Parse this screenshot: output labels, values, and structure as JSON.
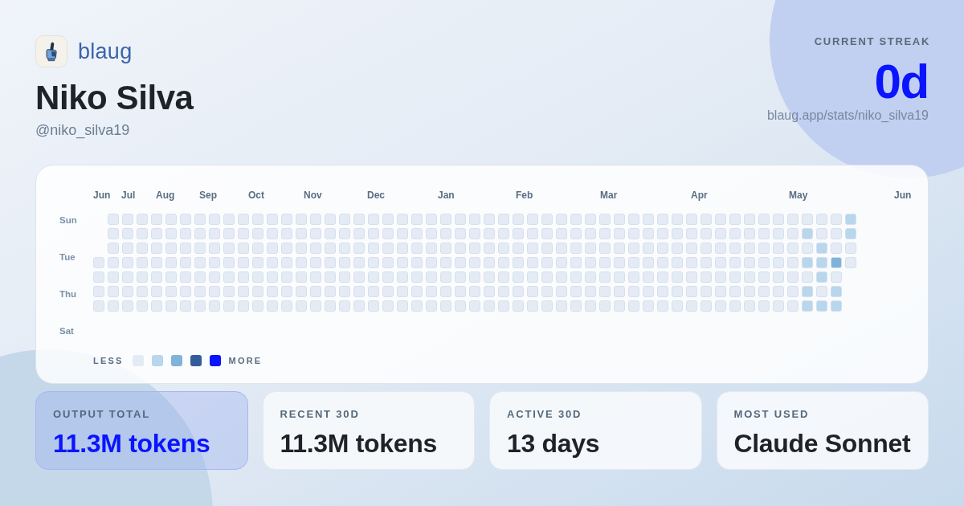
{
  "brand": {
    "name": "blaug"
  },
  "profile": {
    "name": "Niko Silva",
    "handle": "@niko_silva19"
  },
  "streak": {
    "label": "CURRENT STREAK",
    "value": "0d",
    "url": "blaug.app/stats/niko_silva19"
  },
  "heatmap": {
    "months": [
      "Jun",
      "Jul",
      "Aug",
      "Sep",
      "Oct",
      "Nov",
      "Dec",
      "Jan",
      "Feb",
      "Mar",
      "Apr",
      "May",
      "Jun"
    ],
    "weekdays": [
      "Sun",
      "Tue",
      "Thu",
      "Sat"
    ],
    "weeks": [
      {
        "days": [
          {
            "color": "#e4ebf5"
          },
          {
            "color": "#e4ebf5"
          },
          {
            "color": "#e4ebf5"
          },
          {
            "color": "#e4ebf5"
          }
        ]
      },
      {
        "days": [
          {
            "color": "#e4ebf5"
          },
          {
            "color": "#e4ebf5"
          },
          {
            "color": "#e4ebf5"
          },
          {
            "color": "#e4ebf5"
          },
          {
            "color": "#e4ebf5"
          },
          {
            "color": "#e4ebf5"
          },
          {
            "color": "#e4ebf5"
          }
        ]
      },
      {
        "days": [
          {
            "color": "#e4ebf5"
          },
          {
            "color": "#e4ebf5"
          },
          {
            "color": "#e4ebf5"
          },
          {
            "color": "#e4ebf5"
          },
          {
            "color": "#e4ebf5"
          },
          {
            "color": "#e4ebf5"
          },
          {
            "color": "#e4ebf5"
          }
        ]
      },
      {
        "days": [
          {
            "color": "#e4ebf5"
          },
          {
            "color": "#e4ebf5"
          },
          {
            "color": "#e4ebf5"
          },
          {
            "color": "#e4ebf5"
          },
          {
            "color": "#e4ebf5"
          },
          {
            "color": "#e4ebf5"
          },
          {
            "color": "#e4ebf5"
          }
        ]
      },
      {
        "days": [
          {
            "color": "#e4ebf5"
          },
          {
            "color": "#e4ebf5"
          },
          {
            "color": "#e4ebf5"
          },
          {
            "color": "#e4ebf5"
          },
          {
            "color": "#e4ebf5"
          },
          {
            "color": "#e4ebf5"
          },
          {
            "color": "#e4ebf5"
          }
        ]
      },
      {
        "days": [
          {
            "color": "#e4ebf5"
          },
          {
            "color": "#e4ebf5"
          },
          {
            "color": "#e4ebf5"
          },
          {
            "color": "#e4ebf5"
          },
          {
            "color": "#e4ebf5"
          },
          {
            "color": "#e4ebf5"
          },
          {
            "color": "#e4ebf5"
          }
        ]
      },
      {
        "days": [
          {
            "color": "#e4ebf5"
          },
          {
            "color": "#e4ebf5"
          },
          {
            "color": "#e4ebf5"
          },
          {
            "color": "#e4ebf5"
          },
          {
            "color": "#e4ebf5"
          },
          {
            "color": "#e4ebf5"
          },
          {
            "color": "#e4ebf5"
          }
        ]
      },
      {
        "days": [
          {
            "color": "#e4ebf5"
          },
          {
            "color": "#e4ebf5"
          },
          {
            "color": "#e4ebf5"
          },
          {
            "color": "#e4ebf5"
          },
          {
            "color": "#e4ebf5"
          },
          {
            "color": "#e4ebf5"
          },
          {
            "color": "#e4ebf5"
          }
        ]
      },
      {
        "days": [
          {
            "color": "#e4ebf5"
          },
          {
            "color": "#e4ebf5"
          },
          {
            "color": "#e4ebf5"
          },
          {
            "color": "#e4ebf5"
          },
          {
            "color": "#e4ebf5"
          },
          {
            "color": "#e4ebf5"
          },
          {
            "color": "#e4ebf5"
          }
        ]
      },
      {
        "days": [
          {
            "color": "#e4ebf5"
          },
          {
            "color": "#e4ebf5"
          },
          {
            "color": "#e4ebf5"
          },
          {
            "color": "#e4ebf5"
          },
          {
            "color": "#e4ebf5"
          },
          {
            "color": "#e4ebf5"
          },
          {
            "color": "#e4ebf5"
          }
        ]
      },
      {
        "days": [
          {
            "color": "#e4ebf5"
          },
          {
            "color": "#e4ebf5"
          },
          {
            "color": "#e4ebf5"
          },
          {
            "color": "#e4ebf5"
          },
          {
            "color": "#e4ebf5"
          },
          {
            "color": "#e4ebf5"
          },
          {
            "color": "#e4ebf5"
          }
        ]
      },
      {
        "days": [
          {
            "color": "#e4ebf5"
          },
          {
            "color": "#e4ebf5"
          },
          {
            "color": "#e4ebf5"
          },
          {
            "color": "#e4ebf5"
          },
          {
            "color": "#e4ebf5"
          },
          {
            "color": "#e4ebf5"
          },
          {
            "color": "#e4ebf5"
          }
        ]
      },
      {
        "days": [
          {
            "color": "#e4ebf5"
          },
          {
            "color": "#e4ebf5"
          },
          {
            "color": "#e4ebf5"
          },
          {
            "color": "#e4ebf5"
          },
          {
            "color": "#e4ebf5"
          },
          {
            "color": "#e4ebf5"
          },
          {
            "color": "#e4ebf5"
          }
        ]
      },
      {
        "days": [
          {
            "color": "#e4ebf5"
          },
          {
            "color": "#e4ebf5"
          },
          {
            "color": "#e4ebf5"
          },
          {
            "color": "#e4ebf5"
          },
          {
            "color": "#e4ebf5"
          },
          {
            "color": "#e4ebf5"
          },
          {
            "color": "#e4ebf5"
          }
        ]
      },
      {
        "days": [
          {
            "color": "#e4ebf5"
          },
          {
            "color": "#e4ebf5"
          },
          {
            "color": "#e4ebf5"
          },
          {
            "color": "#e4ebf5"
          },
          {
            "color": "#e4ebf5"
          },
          {
            "color": "#e4ebf5"
          },
          {
            "color": "#e4ebf5"
          }
        ]
      },
      {
        "days": [
          {
            "color": "#e4ebf5"
          },
          {
            "color": "#e4ebf5"
          },
          {
            "color": "#e4ebf5"
          },
          {
            "color": "#e4ebf5"
          },
          {
            "color": "#e4ebf5"
          },
          {
            "color": "#e4ebf5"
          },
          {
            "color": "#e4ebf5"
          }
        ]
      },
      {
        "days": [
          {
            "color": "#e4ebf5"
          },
          {
            "color": "#e4ebf5"
          },
          {
            "color": "#e4ebf5"
          },
          {
            "color": "#e4ebf5"
          },
          {
            "color": "#e4ebf5"
          },
          {
            "color": "#e4ebf5"
          },
          {
            "color": "#e4ebf5"
          }
        ]
      },
      {
        "days": [
          {
            "color": "#e4ebf5"
          },
          {
            "color": "#e4ebf5"
          },
          {
            "color": "#e4ebf5"
          },
          {
            "color": "#e4ebf5"
          },
          {
            "color": "#e4ebf5"
          },
          {
            "color": "#e4ebf5"
          },
          {
            "color": "#e4ebf5"
          }
        ]
      },
      {
        "days": [
          {
            "color": "#e4ebf5"
          },
          {
            "color": "#e4ebf5"
          },
          {
            "color": "#e4ebf5"
          },
          {
            "color": "#e4ebf5"
          },
          {
            "color": "#e4ebf5"
          },
          {
            "color": "#e4ebf5"
          },
          {
            "color": "#e4ebf5"
          }
        ]
      },
      {
        "days": [
          {
            "color": "#e4ebf5"
          },
          {
            "color": "#e4ebf5"
          },
          {
            "color": "#e4ebf5"
          },
          {
            "color": "#e4ebf5"
          },
          {
            "color": "#e4ebf5"
          },
          {
            "color": "#e4ebf5"
          },
          {
            "color": "#e4ebf5"
          }
        ]
      },
      {
        "days": [
          {
            "color": "#e4ebf5"
          },
          {
            "color": "#e4ebf5"
          },
          {
            "color": "#e4ebf5"
          },
          {
            "color": "#e4ebf5"
          },
          {
            "color": "#e4ebf5"
          },
          {
            "color": "#e4ebf5"
          },
          {
            "color": "#e4ebf5"
          }
        ]
      },
      {
        "days": [
          {
            "color": "#e4ebf5"
          },
          {
            "color": "#e4ebf5"
          },
          {
            "color": "#e4ebf5"
          },
          {
            "color": "#e4ebf5"
          },
          {
            "color": "#e4ebf5"
          },
          {
            "color": "#e4ebf5"
          },
          {
            "color": "#e4ebf5"
          }
        ]
      },
      {
        "days": [
          {
            "color": "#e4ebf5"
          },
          {
            "color": "#e4ebf5"
          },
          {
            "color": "#e4ebf5"
          },
          {
            "color": "#e4ebf5"
          },
          {
            "color": "#e4ebf5"
          },
          {
            "color": "#e4ebf5"
          },
          {
            "color": "#e4ebf5"
          }
        ]
      },
      {
        "days": [
          {
            "color": "#e4ebf5"
          },
          {
            "color": "#e4ebf5"
          },
          {
            "color": "#e4ebf5"
          },
          {
            "color": "#e4ebf5"
          },
          {
            "color": "#e4ebf5"
          },
          {
            "color": "#e4ebf5"
          },
          {
            "color": "#e4ebf5"
          }
        ]
      },
      {
        "days": [
          {
            "color": "#e4ebf5"
          },
          {
            "color": "#e4ebf5"
          },
          {
            "color": "#e4ebf5"
          },
          {
            "color": "#e4ebf5"
          },
          {
            "color": "#e4ebf5"
          },
          {
            "color": "#e4ebf5"
          },
          {
            "color": "#e4ebf5"
          }
        ]
      },
      {
        "days": [
          {
            "color": "#e4ebf5"
          },
          {
            "color": "#e4ebf5"
          },
          {
            "color": "#e4ebf5"
          },
          {
            "color": "#e4ebf5"
          },
          {
            "color": "#e4ebf5"
          },
          {
            "color": "#e4ebf5"
          },
          {
            "color": "#e4ebf5"
          }
        ]
      },
      {
        "days": [
          {
            "color": "#e4ebf5"
          },
          {
            "color": "#e4ebf5"
          },
          {
            "color": "#e4ebf5"
          },
          {
            "color": "#e4ebf5"
          },
          {
            "color": "#e4ebf5"
          },
          {
            "color": "#e4ebf5"
          },
          {
            "color": "#e4ebf5"
          }
        ]
      },
      {
        "days": [
          {
            "color": "#e4ebf5"
          },
          {
            "color": "#e4ebf5"
          },
          {
            "color": "#e4ebf5"
          },
          {
            "color": "#e4ebf5"
          },
          {
            "color": "#e4ebf5"
          },
          {
            "color": "#e4ebf5"
          },
          {
            "color": "#e4ebf5"
          }
        ]
      },
      {
        "days": [
          {
            "color": "#e4ebf5"
          },
          {
            "color": "#e4ebf5"
          },
          {
            "color": "#e4ebf5"
          },
          {
            "color": "#e4ebf5"
          },
          {
            "color": "#e4ebf5"
          },
          {
            "color": "#e4ebf5"
          },
          {
            "color": "#e4ebf5"
          }
        ]
      },
      {
        "days": [
          {
            "color": "#e4ebf5"
          },
          {
            "color": "#e4ebf5"
          },
          {
            "color": "#e4ebf5"
          },
          {
            "color": "#e4ebf5"
          },
          {
            "color": "#e4ebf5"
          },
          {
            "color": "#e4ebf5"
          },
          {
            "color": "#e4ebf5"
          }
        ]
      },
      {
        "days": [
          {
            "color": "#e4ebf5"
          },
          {
            "color": "#e4ebf5"
          },
          {
            "color": "#e4ebf5"
          },
          {
            "color": "#e4ebf5"
          },
          {
            "color": "#e4ebf5"
          },
          {
            "color": "#e4ebf5"
          },
          {
            "color": "#e4ebf5"
          }
        ]
      },
      {
        "days": [
          {
            "color": "#e4ebf5"
          },
          {
            "color": "#e4ebf5"
          },
          {
            "color": "#e4ebf5"
          },
          {
            "color": "#e4ebf5"
          },
          {
            "color": "#e4ebf5"
          },
          {
            "color": "#e4ebf5"
          },
          {
            "color": "#e4ebf5"
          }
        ]
      },
      {
        "days": [
          {
            "color": "#e4ebf5"
          },
          {
            "color": "#e4ebf5"
          },
          {
            "color": "#e4ebf5"
          },
          {
            "color": "#e4ebf5"
          },
          {
            "color": "#e4ebf5"
          },
          {
            "color": "#e4ebf5"
          },
          {
            "color": "#e4ebf5"
          }
        ]
      },
      {
        "days": [
          {
            "color": "#e4ebf5"
          },
          {
            "color": "#e4ebf5"
          },
          {
            "color": "#e4ebf5"
          },
          {
            "color": "#e4ebf5"
          },
          {
            "color": "#e4ebf5"
          },
          {
            "color": "#e4ebf5"
          },
          {
            "color": "#e4ebf5"
          }
        ]
      },
      {
        "days": [
          {
            "color": "#e4ebf5"
          },
          {
            "color": "#e4ebf5"
          },
          {
            "color": "#e4ebf5"
          },
          {
            "color": "#e4ebf5"
          },
          {
            "color": "#e4ebf5"
          },
          {
            "color": "#e4ebf5"
          },
          {
            "color": "#e4ebf5"
          }
        ]
      },
      {
        "days": [
          {
            "color": "#e4ebf5"
          },
          {
            "color": "#e4ebf5"
          },
          {
            "color": "#e4ebf5"
          },
          {
            "color": "#e4ebf5"
          },
          {
            "color": "#e4ebf5"
          },
          {
            "color": "#e4ebf5"
          },
          {
            "color": "#e4ebf5"
          }
        ]
      },
      {
        "days": [
          {
            "color": "#e4ebf5"
          },
          {
            "color": "#e4ebf5"
          },
          {
            "color": "#e4ebf5"
          },
          {
            "color": "#e4ebf5"
          },
          {
            "color": "#e4ebf5"
          },
          {
            "color": "#e4ebf5"
          },
          {
            "color": "#e4ebf5"
          }
        ]
      },
      {
        "days": [
          {
            "color": "#e4ebf5"
          },
          {
            "color": "#e4ebf5"
          },
          {
            "color": "#e4ebf5"
          },
          {
            "color": "#e4ebf5"
          },
          {
            "color": "#e4ebf5"
          },
          {
            "color": "#e4ebf5"
          },
          {
            "color": "#e4ebf5"
          }
        ]
      },
      {
        "days": [
          {
            "color": "#e4ebf5"
          },
          {
            "color": "#e4ebf5"
          },
          {
            "color": "#e4ebf5"
          },
          {
            "color": "#e4ebf5"
          },
          {
            "color": "#e4ebf5"
          },
          {
            "color": "#e4ebf5"
          },
          {
            "color": "#e4ebf5"
          }
        ]
      },
      {
        "days": [
          {
            "color": "#e4ebf5"
          },
          {
            "color": "#e4ebf5"
          },
          {
            "color": "#e4ebf5"
          },
          {
            "color": "#e4ebf5"
          },
          {
            "color": "#e4ebf5"
          },
          {
            "color": "#e4ebf5"
          },
          {
            "color": "#e4ebf5"
          }
        ]
      },
      {
        "days": [
          {
            "color": "#e4ebf5"
          },
          {
            "color": "#e4ebf5"
          },
          {
            "color": "#e4ebf5"
          },
          {
            "color": "#e4ebf5"
          },
          {
            "color": "#e4ebf5"
          },
          {
            "color": "#e4ebf5"
          },
          {
            "color": "#e4ebf5"
          }
        ]
      },
      {
        "days": [
          {
            "color": "#e4ebf5"
          },
          {
            "color": "#e4ebf5"
          },
          {
            "color": "#e4ebf5"
          },
          {
            "color": "#e4ebf5"
          },
          {
            "color": "#e4ebf5"
          },
          {
            "color": "#e4ebf5"
          },
          {
            "color": "#e4ebf5"
          }
        ]
      },
      {
        "days": [
          {
            "color": "#e4ebf5"
          },
          {
            "color": "#e4ebf5"
          },
          {
            "color": "#e4ebf5"
          },
          {
            "color": "#e4ebf5"
          },
          {
            "color": "#e4ebf5"
          },
          {
            "color": "#e4ebf5"
          },
          {
            "color": "#e4ebf5"
          }
        ]
      },
      {
        "days": [
          {
            "color": "#e4ebf5"
          },
          {
            "color": "#e4ebf5"
          },
          {
            "color": "#e4ebf5"
          },
          {
            "color": "#e4ebf5"
          },
          {
            "color": "#e4ebf5"
          },
          {
            "color": "#e4ebf5"
          },
          {
            "color": "#e4ebf5"
          }
        ]
      },
      {
        "days": [
          {
            "color": "#e4ebf5"
          },
          {
            "color": "#e4ebf5"
          },
          {
            "color": "#e4ebf5"
          },
          {
            "color": "#e4ebf5"
          },
          {
            "color": "#e4ebf5"
          },
          {
            "color": "#e4ebf5"
          },
          {
            "color": "#e4ebf5"
          }
        ]
      },
      {
        "days": [
          {
            "color": "#e4ebf5"
          },
          {
            "color": "#e4ebf5"
          },
          {
            "color": "#e4ebf5"
          },
          {
            "color": "#e4ebf5"
          },
          {
            "color": "#e4ebf5"
          },
          {
            "color": "#e4ebf5"
          },
          {
            "color": "#e4ebf5"
          }
        ]
      },
      {
        "days": [
          {
            "color": "#e4ebf5"
          },
          {
            "color": "#e4ebf5"
          },
          {
            "color": "#e4ebf5"
          },
          {
            "color": "#e4ebf5"
          },
          {
            "color": "#e4ebf5"
          },
          {
            "color": "#e4ebf5"
          },
          {
            "color": "#e4ebf5"
          }
        ]
      },
      {
        "days": [
          {
            "color": "#e4ebf5"
          },
          {
            "color": "#e4ebf5"
          },
          {
            "color": "#e4ebf5"
          },
          {
            "color": "#e4ebf5"
          },
          {
            "color": "#e4ebf5"
          },
          {
            "color": "#e4ebf5"
          },
          {
            "color": "#e4ebf5"
          }
        ]
      },
      {
        "days": [
          {
            "color": "#e4ebf5"
          },
          {
            "color": "#e4ebf5"
          },
          {
            "color": "#e4ebf5"
          },
          {
            "color": "#e4ebf5"
          },
          {
            "color": "#e4ebf5"
          },
          {
            "color": "#e4ebf5"
          },
          {
            "color": "#e4ebf5"
          }
        ]
      },
      {
        "days": [
          {
            "color": "#e4ebf5"
          },
          {
            "color": "#b8d6ec"
          },
          {
            "color": "#e4ebf5"
          },
          {
            "color": "#b8d6ec"
          },
          {
            "color": "#e4ebf5"
          },
          {
            "color": "#b8d6ec"
          },
          {
            "color": "#b8d6ec"
          }
        ]
      },
      {
        "days": [
          {
            "color": "#e4ebf5"
          },
          {
            "color": "#e4ebf5"
          },
          {
            "color": "#b8d6ec"
          },
          {
            "color": "#b8d6ec"
          },
          {
            "color": "#b8d6ec"
          },
          {
            "color": "#e4ebf5"
          },
          {
            "color": "#b8d6ec"
          }
        ]
      },
      {
        "days": [
          {
            "color": "#e4ebf5"
          },
          {
            "color": "#e4ebf5"
          },
          {
            "color": "#e4ebf5"
          },
          {
            "color": "#80b2da"
          },
          {
            "color": "#e4ebf5"
          },
          {
            "color": "#b8d6ec"
          },
          {
            "color": "#b8d6ec"
          }
        ]
      },
      {
        "days": [
          {
            "color": "#b8d6ec"
          },
          {
            "color": "#b8d6ec"
          },
          {
            "color": "#e4ebf5"
          },
          {
            "color": "#e4ebf5"
          }
        ]
      }
    ],
    "legend": {
      "less": "LESS",
      "more": "MORE",
      "swatches": [
        {
          "color": "#e4ebf5"
        },
        {
          "color": "#b8d6ec"
        },
        {
          "color": "#80b2da"
        },
        {
          "color": "#335c9a"
        },
        {
          "color": "#0a14ff"
        }
      ]
    }
  },
  "stats": [
    {
      "label": "OUTPUT TOTAL",
      "value": "11.3M tokens",
      "highlighted": true
    },
    {
      "label": "RECENT 30D",
      "value": "11.3M tokens",
      "highlighted": false
    },
    {
      "label": "ACTIVE 30D",
      "value": "13 days",
      "highlighted": false
    },
    {
      "label": "MOST USED",
      "value": "Claude Sonnet",
      "highlighted": false
    }
  ]
}
